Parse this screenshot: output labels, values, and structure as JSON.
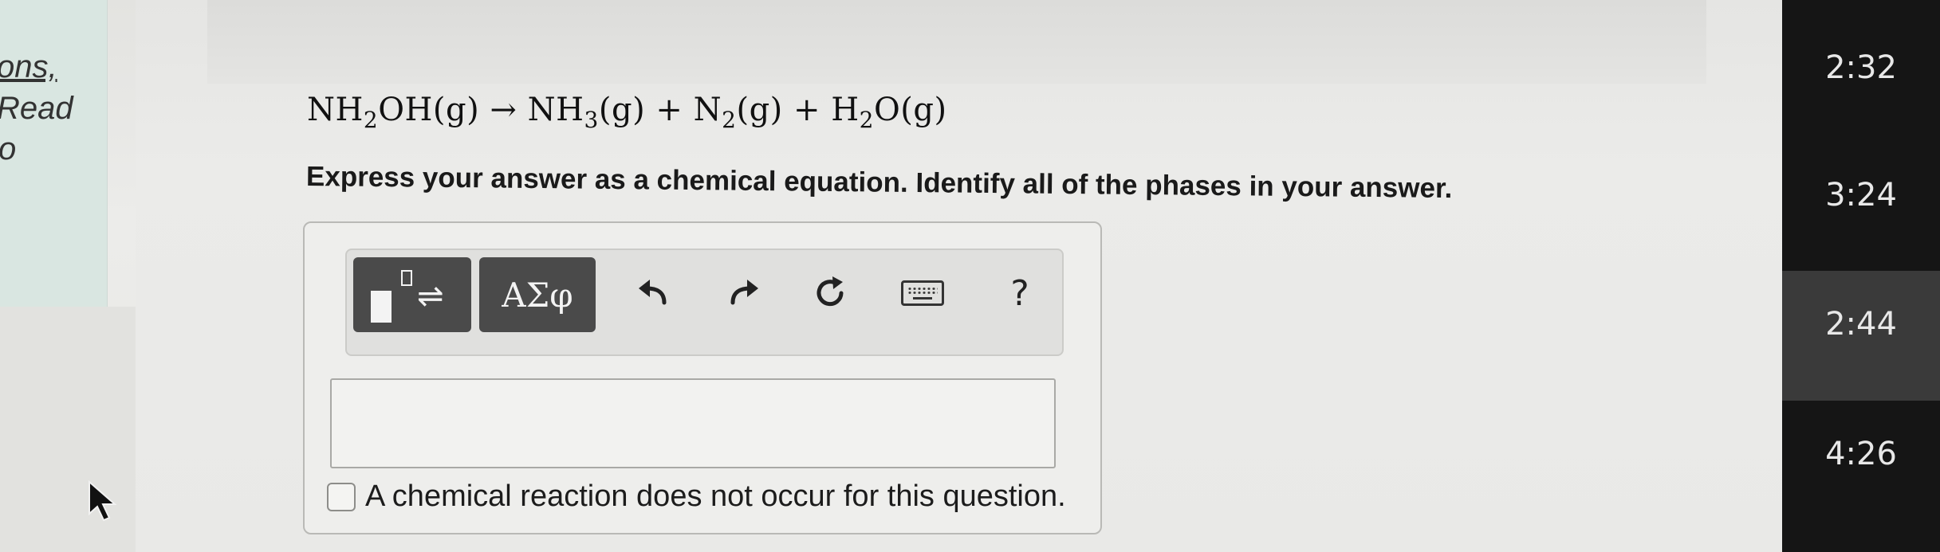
{
  "left_panel": {
    "fragments": [
      "ons,",
      "Read",
      "o"
    ]
  },
  "question": {
    "equation": {
      "parts": [
        "NH",
        "2",
        "OH(g) → NH",
        "3",
        "(g) + N",
        "2",
        "(g) + H",
        "2",
        "O(g)"
      ]
    },
    "instructions": "Express your answer as a chemical equation. Identify all of the phases in your answer."
  },
  "toolbar": {
    "symbols_label": "ΑΣφ",
    "help_label": "?",
    "icons": [
      "templates-icon",
      "undo-icon",
      "redo-icon",
      "reset-icon",
      "keyboard-icon",
      "help-icon"
    ]
  },
  "answer": {
    "input_value": "",
    "no_reaction_label": "A chemical reaction does not occur for this question.",
    "no_reaction_checked": false
  },
  "timestamps": [
    "2:32",
    "3:24",
    "2:44",
    "4:26"
  ],
  "colors": {
    "toolbar_button_dark": "#4a4a4a",
    "right_panel_bg": "#151515",
    "right_panel_selected": "#3a3a3a",
    "left_panel_bg": "#d9e6e1"
  }
}
